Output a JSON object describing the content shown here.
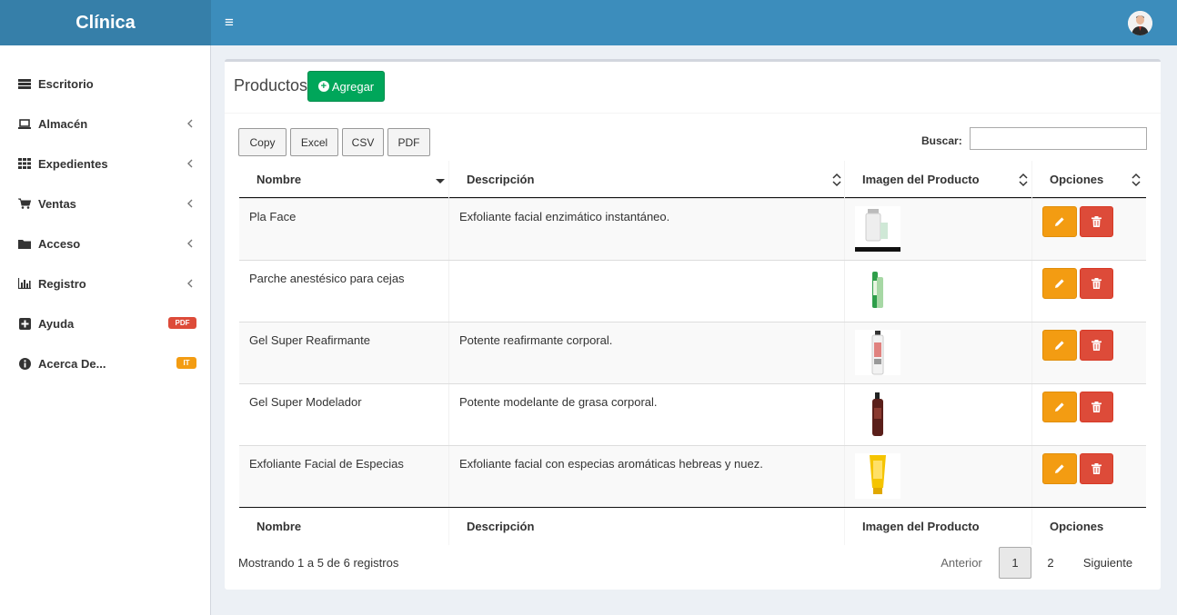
{
  "app": {
    "title": "Clínica"
  },
  "sidebar": {
    "items": [
      {
        "label": "Escritorio",
        "icon": "dashboard-icon"
      },
      {
        "label": "Almacén",
        "icon": "laptop-icon"
      },
      {
        "label": "Expedientes",
        "icon": "grid-icon"
      },
      {
        "label": "Ventas",
        "icon": "cart-icon"
      },
      {
        "label": "Acceso",
        "icon": "folder-icon"
      },
      {
        "label": "Registro",
        "icon": "bar-chart-icon"
      },
      {
        "label": "Ayuda",
        "icon": "plus-square-icon",
        "badge": "PDF"
      },
      {
        "label": "Acerca De...",
        "icon": "info-circle-icon",
        "badge": "IT"
      }
    ]
  },
  "page": {
    "title": "Productos",
    "add_label": "Agregar"
  },
  "export_buttons": [
    "Copy",
    "Excel",
    "CSV",
    "PDF"
  ],
  "search": {
    "label": "Buscar:",
    "value": ""
  },
  "table": {
    "columns": [
      "Nombre",
      "Descripción",
      "Imagen del Producto",
      "Opciones"
    ],
    "rows": [
      {
        "name": "Pla Face",
        "description": "Exfoliante facial enzimático instantáneo.",
        "image": "white-bottle"
      },
      {
        "name": "Parche anestésico para cejas",
        "description": "",
        "image": "green-tube"
      },
      {
        "name": "Gel Super Reafirmante",
        "description": "Potente reafirmante corporal.",
        "image": "white-red-bottle"
      },
      {
        "name": "Gel Super Modelador",
        "description": "Potente modelante de grasa corporal.",
        "image": "brown-bottle"
      },
      {
        "name": "Exfoliante Facial de Especias",
        "description": "Exfoliante facial con especias aromáticas hebreas y nuez.",
        "image": "yellow-tube"
      }
    ]
  },
  "pagination": {
    "info": "Mostrando 1 a 5 de 6 registros",
    "prev": "Anterior",
    "pages": [
      "1",
      "2"
    ],
    "next": "Siguiente",
    "current": "1"
  },
  "colors": {
    "header": "#3c8dbc",
    "logo": "#367fa9",
    "success": "#00a65a",
    "warning": "#f39c12",
    "danger": "#dd4b39"
  }
}
